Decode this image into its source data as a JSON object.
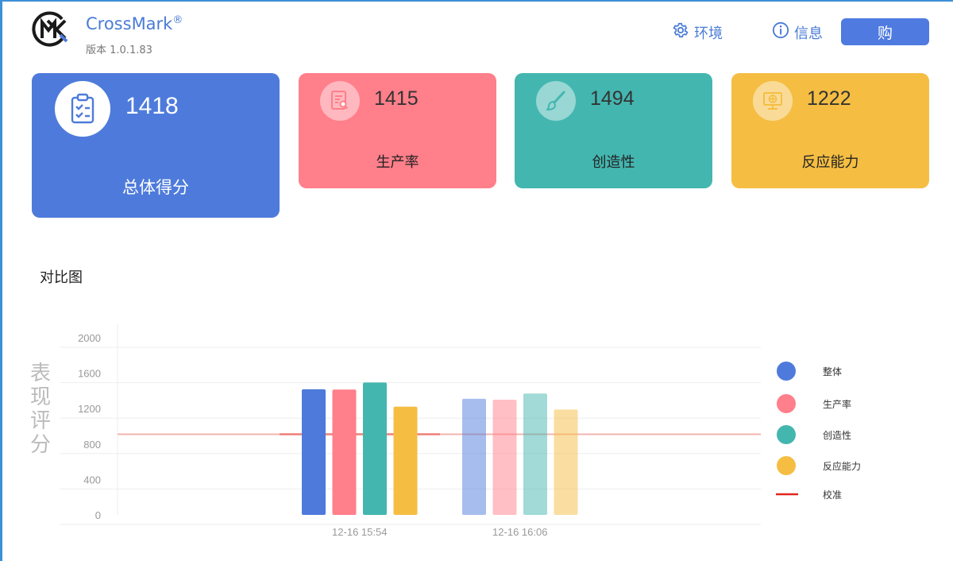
{
  "app": {
    "name": "CrossMark",
    "registered": "®",
    "version": "版本 1.0.1.83"
  },
  "header": {
    "env_label": "环境",
    "info_label": "信息",
    "buy_label": "购"
  },
  "cards": {
    "total": {
      "score": "1418",
      "label": "总体得分",
      "icon": "clipboard-check-icon"
    },
    "productivity": {
      "score": "1415",
      "label": "生产率",
      "icon": "document-search-icon"
    },
    "creativity": {
      "score": "1494",
      "label": "创造性",
      "icon": "paintbrush-icon"
    },
    "responsiveness": {
      "score": "1222",
      "label": "反应能力",
      "icon": "monitor-globe-icon"
    }
  },
  "colors": {
    "total": "#4e7bdb",
    "productivity": "#ff7f8a",
    "creativity": "#44b6b0",
    "responsiveness": "#f5be43",
    "calibration": "#e0281e"
  },
  "section_title": "对比图",
  "chart_data": {
    "type": "bar",
    "ylabel": "表现评分",
    "ylim": [
      0,
      2000
    ],
    "yticks": [
      "0",
      "400",
      "800",
      "1200",
      "1600",
      "2000"
    ],
    "categories": [
      "12-16 15:54",
      "12-16 16:06"
    ],
    "series": [
      {
        "name": "整体",
        "values": [
          1418,
          1310
        ]
      },
      {
        "name": "生产率",
        "values": [
          1415,
          1300
        ]
      },
      {
        "name": "创造性",
        "values": [
          1494,
          1370
        ]
      },
      {
        "name": "反应能力",
        "values": [
          1222,
          1190
        ]
      }
    ],
    "calibration": {
      "name": "校准",
      "value": 1000
    },
    "legend_position": "right",
    "grid": true
  }
}
